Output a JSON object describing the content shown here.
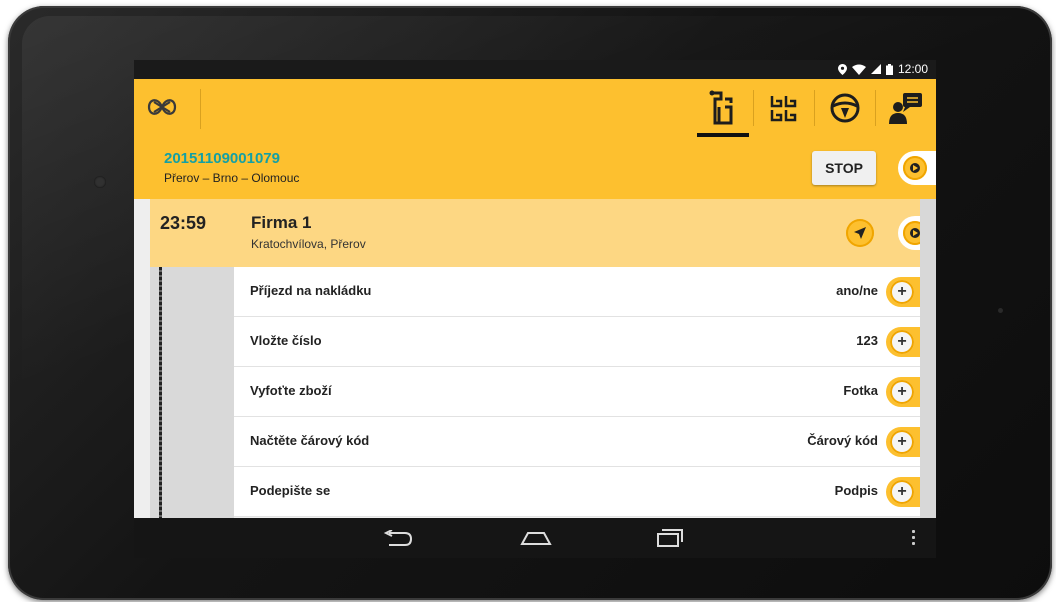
{
  "status": {
    "time": "12:00"
  },
  "header": {
    "logo_icon": "knot-logo-icon",
    "tabs": [
      {
        "name": "route-icon",
        "selected": true
      },
      {
        "name": "grid-icon",
        "selected": false
      },
      {
        "name": "steering-wheel-icon",
        "selected": false
      },
      {
        "name": "driver-message-icon",
        "selected": false
      }
    ]
  },
  "job": {
    "code": "20151109001079",
    "route": "Přerov – Brno – Olomouc",
    "stop_label": "STOP"
  },
  "stop": {
    "time": "23:59",
    "name": "Firma 1",
    "address": "Kratochvílova, Přerov"
  },
  "tasks": [
    {
      "label": "Příjezd na nakládku",
      "value": "ano/ne"
    },
    {
      "label": "Vložte číslo",
      "value": "123"
    },
    {
      "label": "Vyfoťte zboží",
      "value": "Fotka"
    },
    {
      "label": "Načtěte čárový kód",
      "value": "Čárový kód"
    },
    {
      "label": "Podepište se",
      "value": "Podpis"
    }
  ],
  "colors": {
    "accent": "#fdc02f",
    "stop_bg": "#fdd783",
    "job_code": "#14a0a4"
  },
  "plus_symbol": "+"
}
